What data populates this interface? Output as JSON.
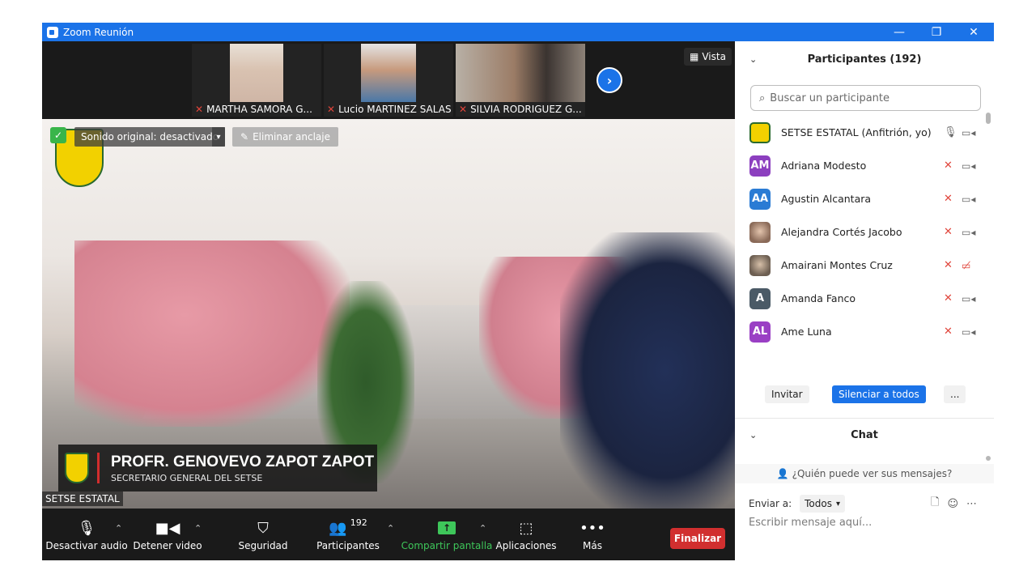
{
  "window": {
    "title": "Zoom Reunión",
    "controls": [
      "—",
      "❐",
      "✕"
    ]
  },
  "gallery": {
    "thumbnails": [
      {
        "name": "MARTHA SAMORA G..."
      },
      {
        "name": "Lucio MARTINEZ SALAS"
      },
      {
        "name": "SILVIA RODRIGUEZ G..."
      }
    ],
    "view_label": "Vista"
  },
  "main_video": {
    "sound_banner": "Sonido original: desactivado",
    "unpin_label": "Eliminar anclaje",
    "speaker_name": "PROFR. GENOVEVO ZAPOT ZAPOT",
    "speaker_role": "SECRETARIO GENERAL DEL SETSE",
    "participant_label": "SETSE ESTATAL"
  },
  "toolbar": {
    "mute_label": "Desactivar audio",
    "video_label": "Detener video",
    "security_label": "Seguridad",
    "participants_label": "Participantes",
    "participants_count": "192",
    "share_label": "Compartir pantalla",
    "apps_label": "Aplicaciones",
    "more_label": "Más",
    "end_label": "Finalizar"
  },
  "participants_panel": {
    "title": "Participantes (192)",
    "search_placeholder": "Buscar un participante",
    "participants": [
      {
        "name": "SETSE ESTATAL (Anfitrión, yo)",
        "initials": "",
        "avatar_color": "#f2d100",
        "muted": false,
        "video_off": false
      },
      {
        "name": "Adriana Modesto",
        "initials": "AM",
        "avatar_color": "#8c3fbf",
        "muted": true,
        "video_off": false
      },
      {
        "name": "Agustin Alcantara",
        "initials": "AA",
        "avatar_color": "#2a7bd4",
        "muted": true,
        "video_off": false
      },
      {
        "name": "Alejandra Cortés Jacobo",
        "initials": "",
        "avatar_color": "#c8a48e",
        "muted": true,
        "video_off": false
      },
      {
        "name": "Amairani Montes Cruz",
        "initials": "",
        "avatar_color": "#9a8a78",
        "muted": true,
        "video_off": true
      },
      {
        "name": "Amanda Fanco",
        "initials": "A",
        "avatar_color": "#4a5a66",
        "muted": true,
        "video_off": false
      },
      {
        "name": "Ame Luna",
        "initials": "AL",
        "avatar_color": "#9a3fc4",
        "muted": true,
        "video_off": false
      }
    ],
    "invite_label": "Invitar",
    "mute_all_label": "Silenciar a todos",
    "more_label": "..."
  },
  "chat_panel": {
    "title": "Chat",
    "who_can_see": "¿Quién puede ver sus mensajes?",
    "send_to_label": "Enviar a:",
    "send_to_value": "Todos",
    "input_placeholder": "Escribir mensaje aquí..."
  },
  "colors": {
    "zoom_blue": "#1b73e8",
    "end_red": "#d12f2f",
    "share_green": "#3ec65a",
    "mute_red": "#e0453b"
  }
}
